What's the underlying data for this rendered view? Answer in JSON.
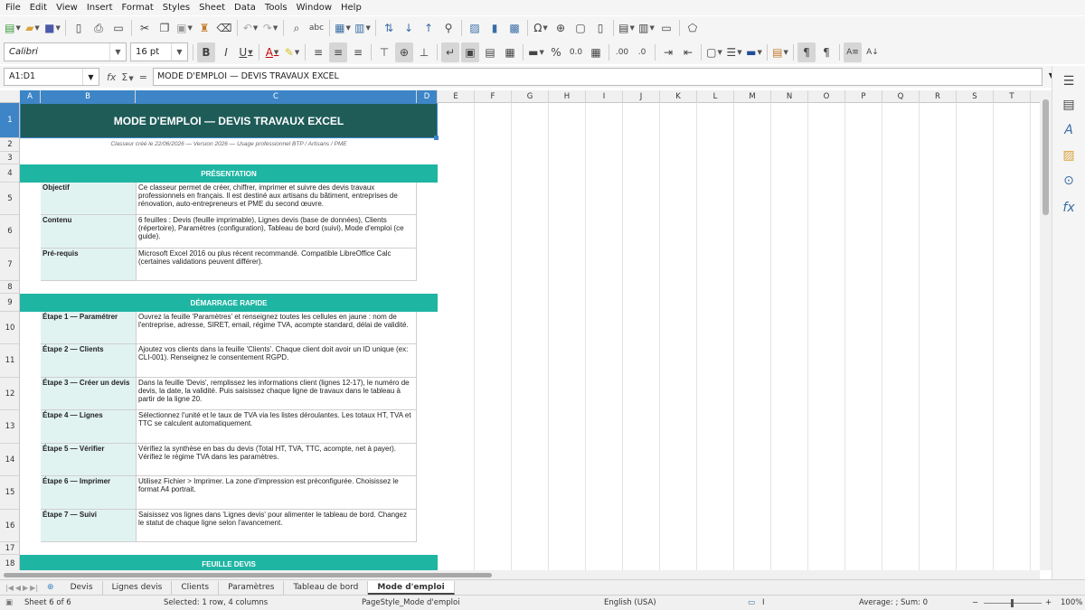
{
  "menu": [
    "File",
    "Edit",
    "View",
    "Insert",
    "Format",
    "Styles",
    "Sheet",
    "Data",
    "Tools",
    "Window",
    "Help"
  ],
  "toolbar": {
    "font_name": "Calibri",
    "font_size": "16 pt",
    "bold": "B",
    "italic": "I",
    "underline": "U",
    "font_color_letter": "A",
    "percent": "%",
    "decimal_label": "0.0"
  },
  "formula": {
    "name_box": "A1:D1",
    "content": "MODE D'EMPLOI — DEVIS TRAVAUX EXCEL"
  },
  "columns": [
    "A",
    "B",
    "C",
    "D",
    "E",
    "F",
    "G",
    "H",
    "I",
    "J",
    "K",
    "L",
    "M",
    "N",
    "O",
    "P",
    "Q",
    "R",
    "S",
    "T"
  ],
  "rows": [
    "1",
    "2",
    "3",
    "4",
    "5",
    "6",
    "7",
    "8",
    "9",
    "10",
    "11",
    "12",
    "13",
    "14",
    "15",
    "16",
    "17",
    "18"
  ],
  "sheet": {
    "title": "MODE D'EMPLOI — DEVIS TRAVAUX EXCEL",
    "subtitle": "Classeur créé le 22/06/2026 — Version 2026 — Usage professionnel BTP / Artisans / PME",
    "section_presentation": "PRÉSENTATION",
    "presentation": [
      {
        "key": "Objectif",
        "value": "Ce classeur permet de créer, chiffrer, imprimer et suivre des devis travaux professionnels en français. Il est destiné aux artisans du bâtiment, entreprises de rénovation, auto-entrepreneurs et PME du second œuvre."
      },
      {
        "key": "Contenu",
        "value": "6 feuilles : Devis (feuille imprimable), Lignes devis (base de données), Clients (répertoire), Paramètres (configuration), Tableau de bord (suivi), Mode d'emploi (ce guide)."
      },
      {
        "key": "Pré-requis",
        "value": "Microsoft Excel 2016 ou plus récent recommandé. Compatible LibreOffice Calc (certaines validations peuvent différer)."
      }
    ],
    "section_quickstart": "DÉMARRAGE RAPIDE",
    "steps": [
      {
        "key": "Étape 1 — Paramétrer",
        "value": "Ouvrez la feuille 'Paramètres' et renseignez toutes les cellules en jaune : nom de l'entreprise, adresse, SIRET, email, régime TVA, acompte standard, délai de validité."
      },
      {
        "key": "Étape 2 — Clients",
        "value": "Ajoutez vos clients dans la feuille 'Clients'. Chaque client doit avoir un ID unique (ex: CLI-001). Renseignez le consentement RGPD."
      },
      {
        "key": "Étape 3 — Créer un devis",
        "value": "Dans la feuille 'Devis', remplissez les informations client (lignes 12-17), le numéro de devis, la date, la validité. Puis saisissez chaque ligne de travaux dans le tableau à partir de la ligne 20."
      },
      {
        "key": "Étape 4 — Lignes",
        "value": "Sélectionnez l'unité et le taux de TVA via les listes déroulantes. Les totaux HT, TVA et TTC se calculent automatiquement."
      },
      {
        "key": "Étape 5 — Vérifier",
        "value": "Vérifiez la synthèse en bas du devis (Total HT, TVA, TTC, acompte, net à payer). Vérifiez le régime TVA dans les paramètres."
      },
      {
        "key": "Étape 6 — Imprimer",
        "value": "Utilisez Fichier > Imprimer. La zone d'impression est préconfigurée. Choisissez le format A4 portrait."
      },
      {
        "key": "Étape 7 — Suivi",
        "value": "Saisissez vos lignes dans 'Lignes devis' pour alimenter le tableau de bord. Changez le statut de chaque ligne selon l'avancement."
      }
    ],
    "section_feuille": "FEUILLE DEVIS"
  },
  "tabs": [
    "Devis",
    "Lignes devis",
    "Clients",
    "Paramètres",
    "Tableau de bord",
    "Mode d'emploi"
  ],
  "active_tab": "Mode d'emploi",
  "status": {
    "sheet": "Sheet 6 of 6",
    "selection": "Selected: 1 row, 4 columns",
    "page_style": "PageStyle_Mode d'emploi",
    "language": "English (USA)",
    "summary": "Average: ; Sum: 0",
    "zoom": "100%"
  },
  "colors": {
    "banner": "#1f5c58",
    "section": "#1fb5a3",
    "key_fill": "#e1f3f1",
    "selection": "#3d85c6"
  }
}
